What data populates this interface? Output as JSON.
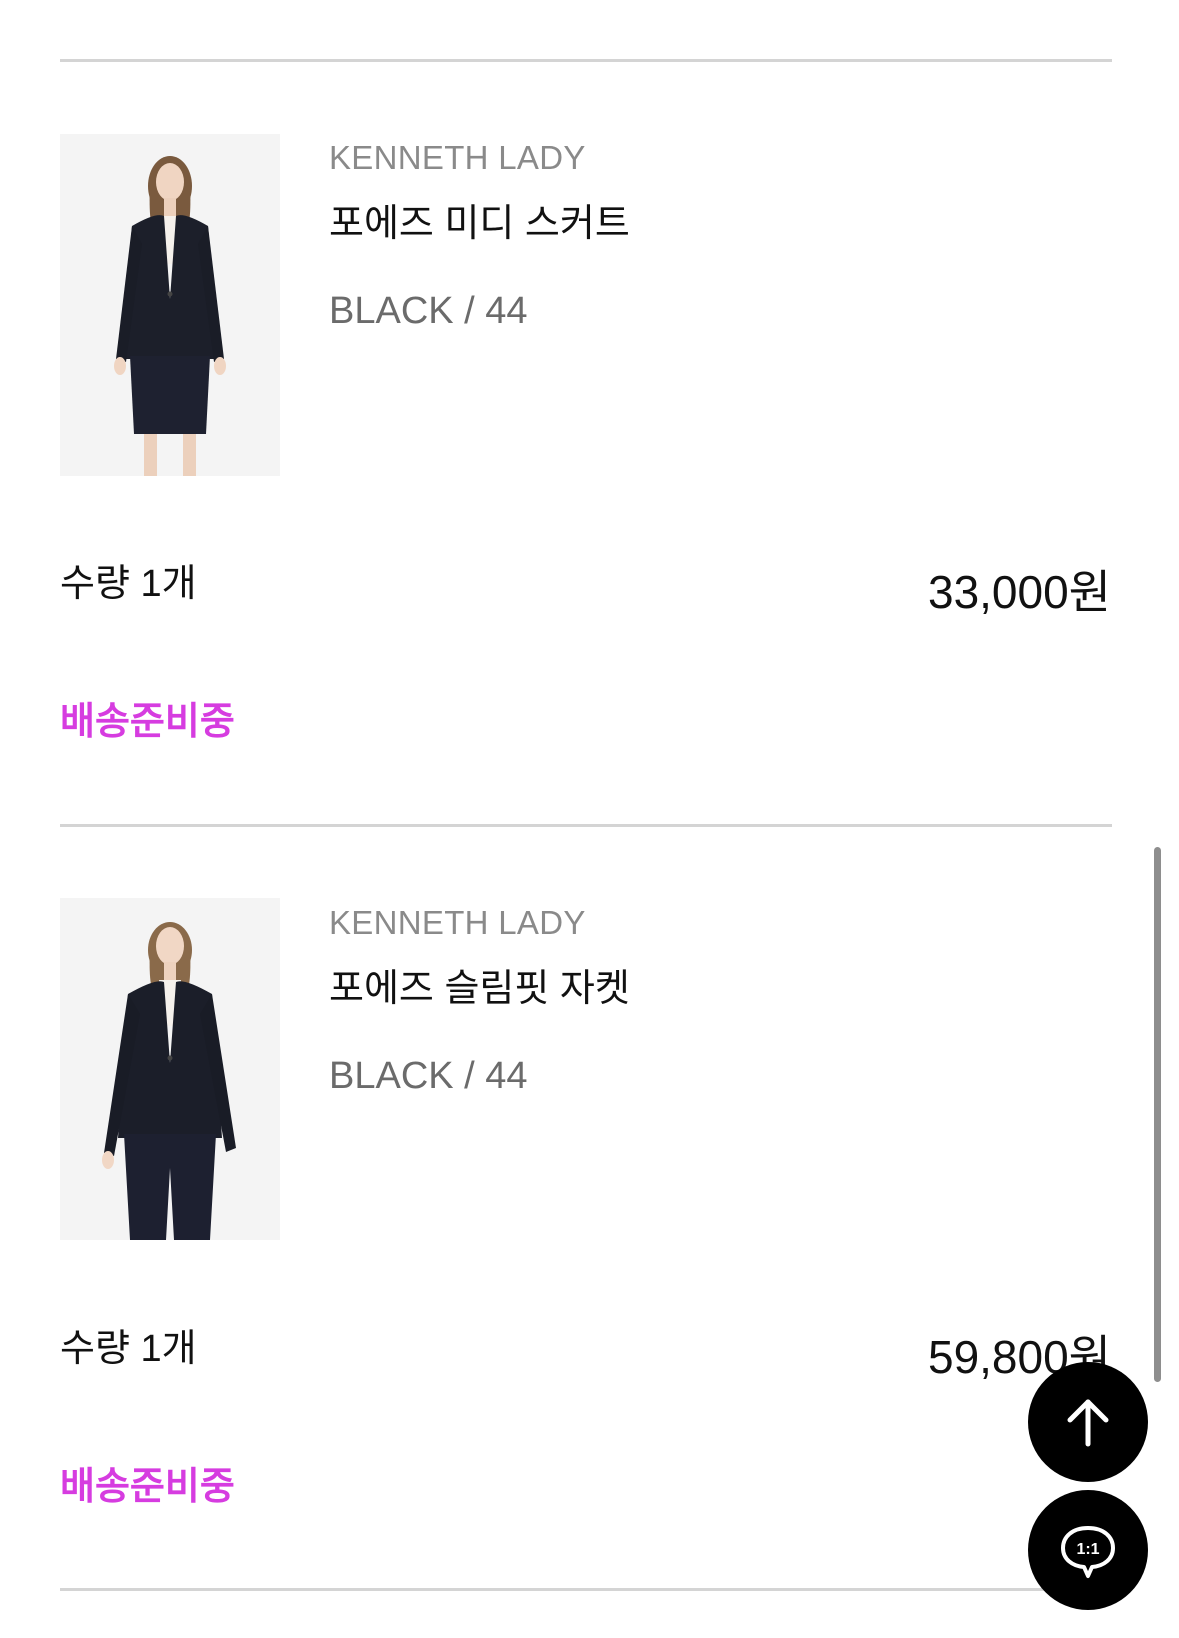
{
  "order_items": [
    {
      "brand": "KENNETH LADY",
      "name": "포에즈 미디 스커트",
      "option": "BLACK / 44",
      "quantity": "수량 1개",
      "price": "33,000원",
      "status": "배송준비중",
      "image": "model-suit-skirt"
    },
    {
      "brand": "KENNETH LADY",
      "name": "포에즈 슬림핏 자켓",
      "option": "BLACK / 44",
      "quantity": "수량 1개",
      "price": "59,800원",
      "status": "배송준비중",
      "image": "model-suit-pants"
    }
  ],
  "floating": {
    "scroll_top_icon": "arrow-up-icon",
    "chat_icon": "chat-bubble-icon",
    "chat_label": "1:1"
  },
  "colors": {
    "status": "#d63ce0",
    "fab_bg": "#000000",
    "divider": "#d4d4d4"
  }
}
